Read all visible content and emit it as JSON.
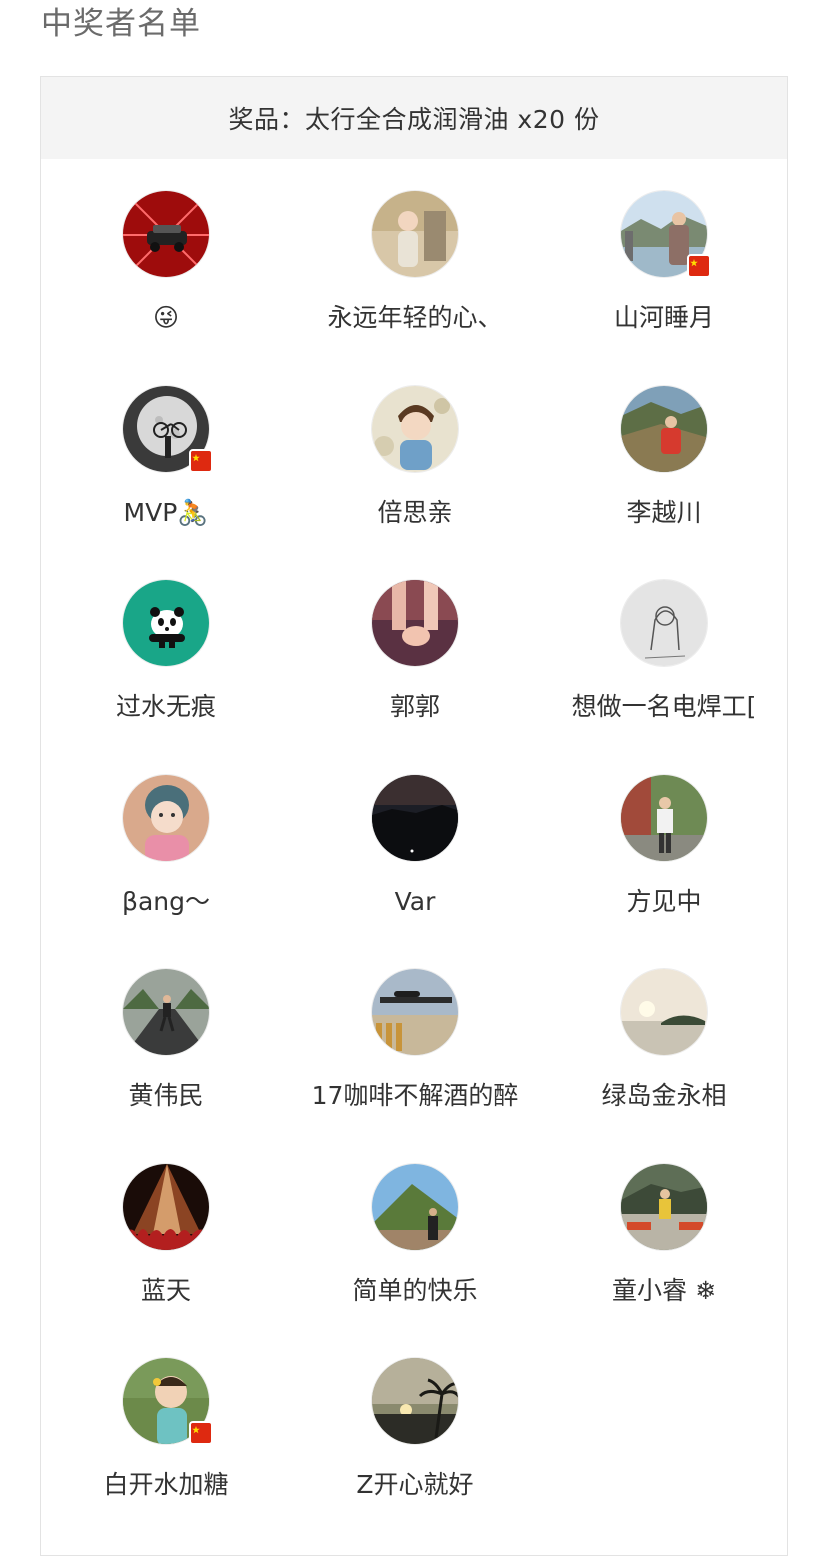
{
  "page": {
    "title": "中奖者名单"
  },
  "prize": {
    "label": "奖品：太行全合成润滑油 x20 份"
  },
  "winners": [
    {
      "name": "😜",
      "avatar": "red-car-avatar",
      "flag": false
    },
    {
      "name": "永远年轻的心、",
      "avatar": "child-photo-avatar",
      "flag": false
    },
    {
      "name": "山河睡月",
      "avatar": "lake-portrait-avatar",
      "flag": true
    },
    {
      "name": "MVP🚴",
      "avatar": "moon-bicycle-avatar",
      "flag": true
    },
    {
      "name": "倍思亲",
      "avatar": "cartoon-boy-avatar",
      "flag": false
    },
    {
      "name": "李越川",
      "avatar": "mountain-hiker-avatar",
      "flag": false
    },
    {
      "name": "过水无痕",
      "avatar": "panda-avatar",
      "flag": false
    },
    {
      "name": "郭郭",
      "avatar": "holding-hands-avatar",
      "flag": false
    },
    {
      "name": "想做一名电焊工[",
      "avatar": "sketch-avatar",
      "flag": false
    },
    {
      "name": "βang～",
      "avatar": "little-girl-avatar",
      "flag": false
    },
    {
      "name": "Var",
      "avatar": "night-sky-avatar",
      "flag": false
    },
    {
      "name": "方见中",
      "avatar": "garden-man-avatar",
      "flag": false
    },
    {
      "name": "黄伟民",
      "avatar": "road-runner-avatar",
      "flag": false
    },
    {
      "name": "17咖啡不解酒的醉",
      "avatar": "rifle-avatar",
      "flag": false
    },
    {
      "name": "绿岛金永相",
      "avatar": "island-sunset-avatar",
      "flag": false
    },
    {
      "name": "蓝天",
      "avatar": "concert-avatar",
      "flag": false
    },
    {
      "name": "简单的快乐",
      "avatar": "green-hill-avatar",
      "flag": false
    },
    {
      "name": "童小睿 ❄",
      "avatar": "park-child-avatar",
      "flag": false
    },
    {
      "name": "白开水加糖",
      "avatar": "toddler-avatar",
      "flag": true
    },
    {
      "name": "Z开心就好",
      "avatar": "palm-sunset-avatar",
      "flag": false
    }
  ]
}
